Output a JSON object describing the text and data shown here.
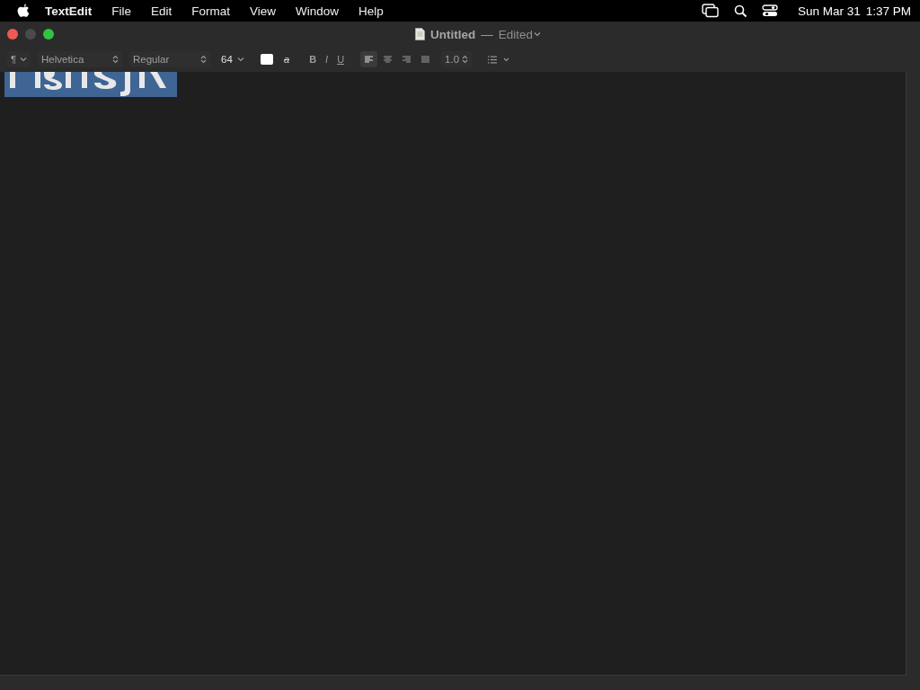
{
  "menubar": {
    "items": [
      {
        "label": "TextEdit",
        "kind": "app"
      },
      {
        "label": "File",
        "kind": "menu"
      },
      {
        "label": "Edit",
        "kind": "menu"
      },
      {
        "label": "Format",
        "kind": "menu"
      },
      {
        "label": "View",
        "kind": "menu"
      },
      {
        "label": "Window",
        "kind": "menu"
      },
      {
        "label": "Help",
        "kind": "menu"
      }
    ],
    "date": "Sun Mar 31",
    "time": "1:37 PM"
  },
  "window": {
    "title": "Untitled",
    "separator": "—",
    "status": "Edited"
  },
  "toolbar": {
    "paragraph_style": "¶",
    "font_family": "Helvetica",
    "typeface": "Regular",
    "font_size": "64",
    "highlight": "a",
    "bold": "B",
    "italic": "I",
    "underline": "U",
    "alignments": [
      {
        "selected": true
      },
      {
        "selected": false
      },
      {
        "selected": false
      },
      {
        "selected": false
      }
    ],
    "line_spacing": "1.0"
  },
  "document": {
    "selected": true
  }
}
